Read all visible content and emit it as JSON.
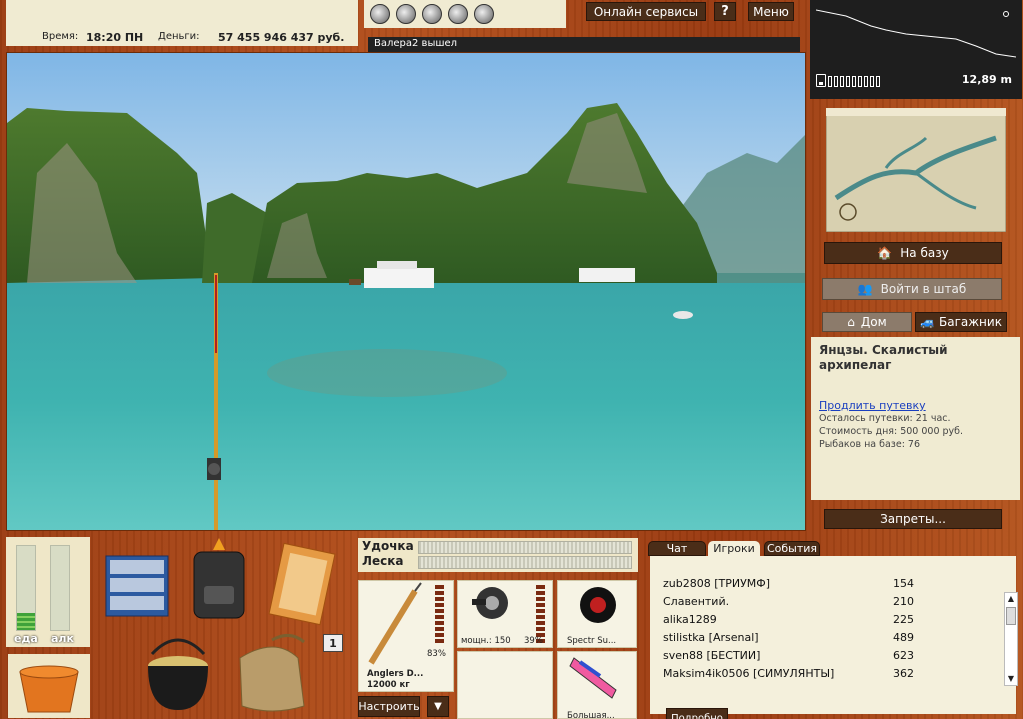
{
  "status": {
    "time_label": "Время:",
    "time_value": "18:20 ПН",
    "money_label": "Деньги:",
    "money_value": "57 455 946 437 руб."
  },
  "top_menu": {
    "online_services": "Онлайн сервисы",
    "help": "?",
    "menu": "Меню"
  },
  "notice": "Валера2 вышел",
  "depth": {
    "value": "12,89 m"
  },
  "side": {
    "to_base": "На базу",
    "hq": "Войти в штаб",
    "home": "Дом",
    "trunk": "Багажник",
    "location_name": "Янцзы. Скалистый архипелаг",
    "extend_trip": "Продлить путевку",
    "trip_left": "Осталось путевки: 21 час.",
    "day_cost": "Стоимость дня: 500 000 руб.",
    "anglers": "Рыбаков на базе: 76",
    "bans": "Запреты..."
  },
  "meters": {
    "food_label": "еда",
    "alcohol_label": "алк",
    "food_level": 0.2,
    "alcohol_level": 0
  },
  "tackle_count": "1",
  "tackle": {
    "rod_label": "Удочка",
    "line_label": "Леска",
    "rod_name": "Anglers D...",
    "rod_capacity": "12000 кг",
    "rod_percent": "83%",
    "reel_power": "мощн.: 150",
    "reel_percent": "39%",
    "line_name": "Spectr Su...",
    "lure_name": "Большая...",
    "adjust": "Настроить",
    "arrow": "▼"
  },
  "chat": {
    "tabs": [
      "Чат",
      "Игроки",
      "События"
    ],
    "players": [
      {
        "name": "zub2808 [ТРИУМФ]",
        "score": "154"
      },
      {
        "name": "Славентий.",
        "score": "210"
      },
      {
        "name": "alika1289",
        "score": "225"
      },
      {
        "name": "stilistka [Arsenal]",
        "score": "489"
      },
      {
        "name": "sven88 [БЕСТИИ]",
        "score": "623"
      },
      {
        "name": "Maksim4ik0506 [СИМУЛЯНТЫ]",
        "score": "362"
      }
    ],
    "details": "Подробно"
  }
}
